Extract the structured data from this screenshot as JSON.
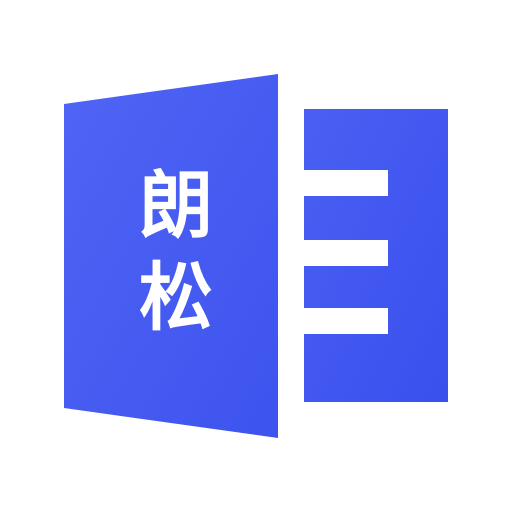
{
  "logo": {
    "name": "document-door-logo",
    "line1": "朗",
    "line2": "松",
    "colors": {
      "background": "#ffffff",
      "gradient_start": "#4b63f2",
      "gradient_end": "#3f55f0",
      "text": "#ffffff"
    }
  }
}
